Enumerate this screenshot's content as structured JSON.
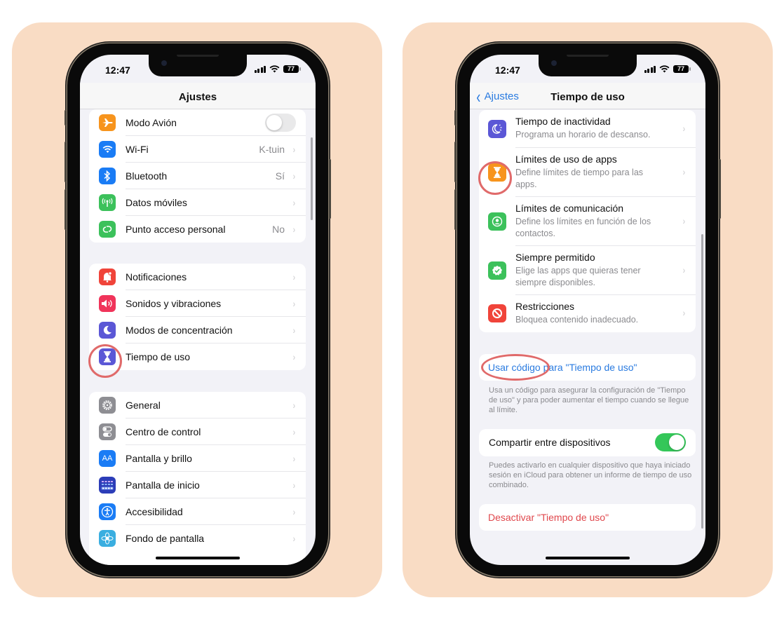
{
  "colors": {
    "panel_bg": "#f9dcc4",
    "ios_blue": "#2a7be0",
    "ios_red": "#e0474c",
    "highlight": "#e06a6a",
    "toggle_on": "#34c759"
  },
  "left_phone": {
    "status_bar": {
      "time": "12:47",
      "battery": "77",
      "icons": [
        "cellular-signal-icon",
        "wifi-icon",
        "battery-icon"
      ]
    },
    "navbar": {
      "title": "Ajustes"
    },
    "groups": [
      {
        "items": [
          {
            "label": "Modo Avión",
            "icon": "airplane-icon",
            "icon_color": "#f7941d",
            "toggle": false
          },
          {
            "label": "Wi-Fi",
            "icon": "wifi-icon",
            "icon_color": "#1a7cf5",
            "value": "K-tuin"
          },
          {
            "label": "Bluetooth",
            "icon": "bluetooth-icon",
            "icon_color": "#1a7cf5",
            "value": "Sí"
          },
          {
            "label": "Datos móviles",
            "icon": "antenna-icon",
            "icon_color": "#3cc15b",
            "value": ""
          },
          {
            "label": "Punto acceso personal",
            "icon": "hotspot-link-icon",
            "icon_color": "#3cc15b",
            "value": "No"
          }
        ]
      },
      {
        "items": [
          {
            "label": "Notificaciones",
            "icon": "bell-icon",
            "icon_color": "#f0443a"
          },
          {
            "label": "Sonidos y vibraciones",
            "icon": "speaker-icon",
            "icon_color": "#f0345a"
          },
          {
            "label": "Modos de concentración",
            "icon": "moon-icon",
            "icon_color": "#5b57d6"
          },
          {
            "label": "Tiempo de uso",
            "icon": "hourglass-icon",
            "icon_color": "#5b57d6",
            "highlighted": true
          }
        ]
      },
      {
        "items": [
          {
            "label": "General",
            "icon": "gear-icon",
            "icon_color": "#8e8e93"
          },
          {
            "label": "Centro de control",
            "icon": "switches-icon",
            "icon_color": "#8e8e93"
          },
          {
            "label": "Pantalla y brillo",
            "icon": "text-size-icon",
            "icon_color": "#1a7cf5"
          },
          {
            "label": "Pantalla de inicio",
            "icon": "home-grid-icon",
            "icon_color": "#2c3db8"
          },
          {
            "label": "Accesibilidad",
            "icon": "accessibility-icon",
            "icon_color": "#1a7cf5"
          },
          {
            "label": "Fondo de pantalla",
            "icon": "flower-icon",
            "icon_color": "#3aaee0"
          }
        ]
      }
    ]
  },
  "right_phone": {
    "status_bar": {
      "time": "12:47",
      "battery": "77",
      "icons": [
        "cellular-signal-icon",
        "wifi-icon",
        "battery-icon"
      ]
    },
    "navbar": {
      "back_label": "Ajustes",
      "title": "Tiempo de uso"
    },
    "items": [
      {
        "title": "Tiempo de inactividad",
        "subtitle": "Programa un horario de descanso.",
        "icon": "downtime-icon",
        "icon_color": "#5b57d6"
      },
      {
        "title": "Límites de uso de apps",
        "subtitle": "Define límites de tiempo para las apps.",
        "icon": "hourglass-icon",
        "icon_color": "#f7941d",
        "highlighted": true
      },
      {
        "title": "Límites de comunicación",
        "subtitle": "Define los límites en función de los contactos.",
        "icon": "contact-icon",
        "icon_color": "#3cc15b"
      },
      {
        "title": "Siempre permitido",
        "subtitle": "Elige las apps que quieras tener siempre disponibles.",
        "icon": "checkmark-badge-icon",
        "icon_color": "#3cc15b"
      },
      {
        "title": "Restricciones",
        "subtitle": "Bloquea contenido inadecuado.",
        "icon": "block-icon",
        "icon_color": "#f0443a"
      }
    ],
    "passcode": {
      "label": "Usar código para \"Tiempo de uso\"",
      "footer": "Usa un código para asegurar la configuración de \"Tiempo de uso\" y para poder aumentar el tiempo cuando se llegue al límite."
    },
    "share": {
      "label": "Compartir entre dispositivos",
      "enabled": true,
      "footer": "Puedes activarlo en cualquier dispositivo que haya iniciado sesión en iCloud para obtener un informe de tiempo de uso combinado."
    },
    "deactivate": {
      "label": "Desactivar \"Tiempo de uso\""
    }
  },
  "glyphs": {
    "chevron": "›",
    "back_chevron": "‹"
  }
}
